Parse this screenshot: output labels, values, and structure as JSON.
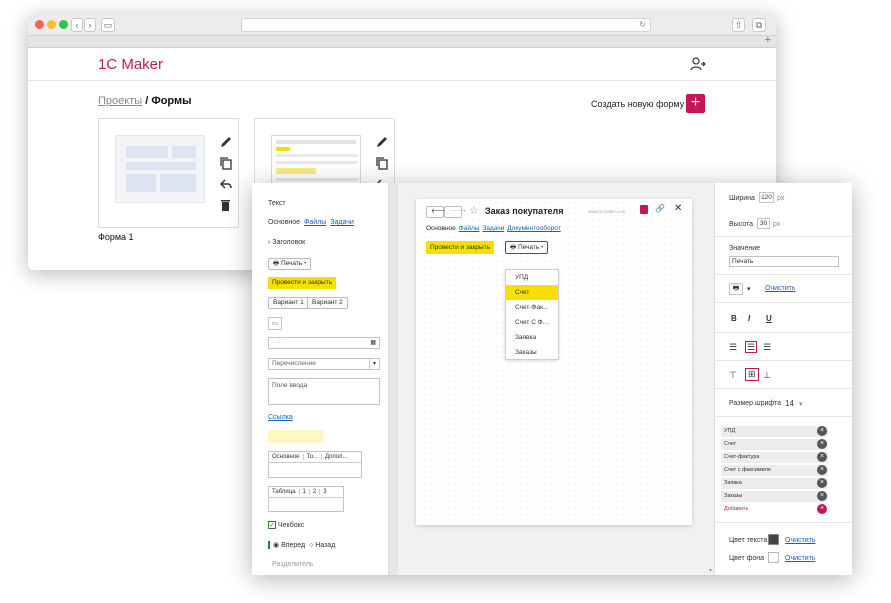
{
  "app": {
    "brand": "1C Maker"
  },
  "breadcrumb": {
    "projects": "Проекты",
    "separator": " / ",
    "current": "Формы"
  },
  "actions": {
    "create_form": "Создать новую форму",
    "create_plus": "+"
  },
  "forms": [
    {
      "label": "Форма 1"
    }
  ],
  "palette": {
    "title": "Текст",
    "tabs": [
      "Основное",
      "Файлы",
      "Задачи"
    ],
    "header_item": "Заголовок",
    "print_button": "Печать",
    "post_close_button": "Провести и закрыть",
    "variants": [
      "Вариант 1",
      "Вариант 2"
    ],
    "small_icon_text": "ico",
    "date_placeholder": ". . : :",
    "enum_placeholder": "Перечисление",
    "input_placeholder": "Поле ввода",
    "link": "Ссылка",
    "tabs_widget": [
      "Основное",
      "То...",
      "Допол..."
    ],
    "table_cols": [
      "Таблица",
      "1",
      "2",
      "3"
    ],
    "checkbox_label": "Чекбокс",
    "radio_forward": "Вперед",
    "radio_back": "Назад",
    "separator_label": "Разделитель"
  },
  "canvas": {
    "title": "Заказ покупателя",
    "site": "www.1cmaker.com",
    "tabs": [
      "Основное",
      "Файлы",
      "Задачи",
      "Документооборот"
    ],
    "post_close_button": "Провести и закрыть",
    "print_button": "Печать",
    "print_menu": [
      "УПД",
      "Счет",
      "Счет-Фак...",
      "Счет С Ф...",
      "Заявка",
      "Заказы"
    ],
    "print_menu_selected": "Счет"
  },
  "props": {
    "width_label": "Ширина",
    "width_value": "120",
    "width_unit": "px",
    "height_label": "Высота",
    "height_value": "30",
    "height_unit": "px",
    "value_label": "Значение",
    "value_value": "Печать",
    "clear_link": "Очистить",
    "bold": "B",
    "italic": "I",
    "underline": "U",
    "font_size_label": "Размер шрифта",
    "font_size_value": "14",
    "menu_items": [
      "УПД",
      "Счет",
      "Счет-фактура",
      "Счет с факсимиле",
      "Заявка",
      "Заказы"
    ],
    "add_label": "Добавить",
    "text_color_label": "Цвет текста",
    "text_color": "#444444",
    "bg_color_label": "Цвет фона",
    "bg_color": "#ffffff"
  },
  "colors": {
    "accent": "#c2185b",
    "highlight": "#f5e000",
    "link": "#1a5fb4"
  }
}
